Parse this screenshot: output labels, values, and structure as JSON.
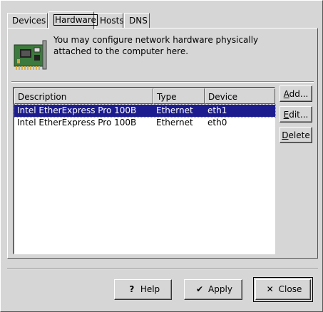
{
  "tabs": [
    {
      "label": "Devices"
    },
    {
      "label": "Hardware"
    },
    {
      "label": "Hosts"
    },
    {
      "label": "DNS"
    }
  ],
  "active_tab": "Hardware",
  "info": {
    "line1": "You may configure network hardware physically",
    "line2": "attached to the computer here.",
    "icon": "network-card-icon"
  },
  "list": {
    "columns": [
      "Description",
      "Type",
      "Device"
    ],
    "rows": [
      {
        "description": "Intel EtherExpress Pro 100B",
        "type": "Ethernet",
        "device": "eth1",
        "selected": true
      },
      {
        "description": "Intel EtherExpress Pro 100B",
        "type": "Ethernet",
        "device": "eth0",
        "selected": false
      }
    ]
  },
  "side_buttons": {
    "add_u": "A",
    "add_rest": "dd...",
    "edit_u": "E",
    "edit_rest": "dit...",
    "delete_u": "D",
    "delete_rest": "elete"
  },
  "dialog_buttons": {
    "help": "Help",
    "apply": "Apply",
    "close": "Close"
  },
  "colors": {
    "window_bg": "#d6d6d6",
    "selection_bg": "#1c1c8e",
    "selection_fg": "#ffffff"
  }
}
